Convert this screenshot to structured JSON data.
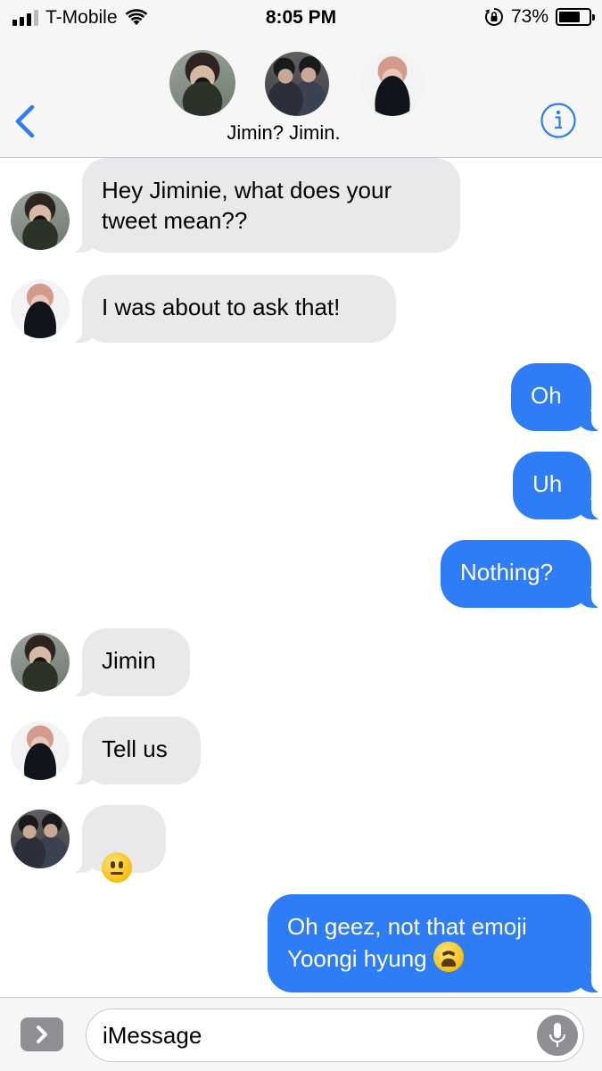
{
  "status_bar": {
    "carrier": "T-Mobile",
    "time": "8:05 PM",
    "battery_percent": "73%",
    "battery_level": 0.73
  },
  "header": {
    "group_name": "Jimin? Jimin.",
    "participants": [
      "jungkook-avatar",
      "group-photo-avatar",
      "jimin-avatar"
    ]
  },
  "messages": [
    {
      "direction": "in",
      "sender_avatar": "jungkook-avatar",
      "text": "Hey Jiminie, what does your\ntweet mean??"
    },
    {
      "direction": "in",
      "sender_avatar": "jimin-avatar",
      "text": "I was about to ask that!"
    },
    {
      "direction": "out",
      "text": "Oh"
    },
    {
      "direction": "out",
      "text": "Uh"
    },
    {
      "direction": "out",
      "text": "Nothing?"
    },
    {
      "direction": "in",
      "sender_avatar": "jungkook-avatar",
      "text": "Jimin"
    },
    {
      "direction": "in",
      "sender_avatar": "jimin-avatar",
      "text": "Tell us"
    },
    {
      "direction": "in",
      "sender_avatar": "group-photo-avatar",
      "emoji": "neutral-face-emoji"
    },
    {
      "direction": "out",
      "text": "Oh geez, not that emoji\nYoongi hyung",
      "emoji": "weary-face-emoji"
    }
  ],
  "composer": {
    "placeholder": "iMessage"
  },
  "colors": {
    "outgoing_bubble": "#2e7cf6",
    "incoming_bubble": "#e9e9eb",
    "accent": "#2e7cf6"
  }
}
